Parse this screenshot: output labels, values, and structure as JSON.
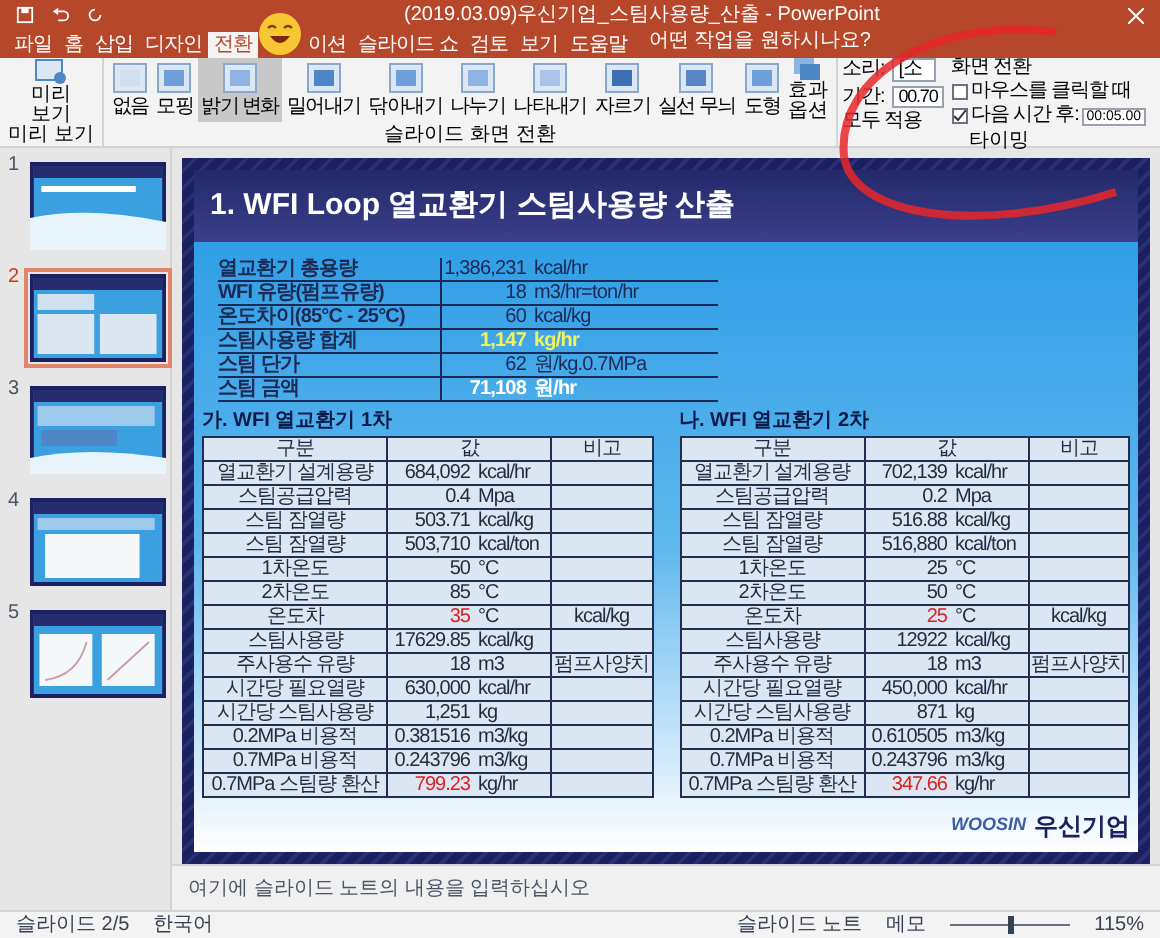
{
  "title_bar": {
    "title": "(2019.03.09)우신기업_스팀사용량_산출 - PowerPoint"
  },
  "menu_tabs": [
    {
      "label": "파일",
      "selected": false
    },
    {
      "label": "홈",
      "selected": false
    },
    {
      "label": "삽입",
      "selected": false
    },
    {
      "label": "디자인",
      "selected": false
    },
    {
      "label": "전환",
      "selected": true
    },
    {
      "label": "이션",
      "selected": false
    },
    {
      "label": "슬라이드 쇼",
      "selected": false
    },
    {
      "label": "검토",
      "selected": false
    },
    {
      "label": "보기",
      "selected": false
    },
    {
      "label": "도움말",
      "selected": false
    }
  ],
  "tell_me": "어떤 작업을 원하시나요?",
  "ribbon": {
    "preview": {
      "label": "미리 보기",
      "group": "미리 보기"
    },
    "transitions": [
      {
        "label": "없음",
        "selected": false
      },
      {
        "label": "모핑",
        "selected": false
      },
      {
        "label": "밝기 변화",
        "selected": true
      },
      {
        "label": "밀어내기",
        "selected": false
      },
      {
        "label": "닦아내기",
        "selected": false
      },
      {
        "label": "나누기",
        "selected": false
      },
      {
        "label": "나타내기",
        "selected": false
      },
      {
        "label": "자르기",
        "selected": false
      },
      {
        "label": "실선 무늬",
        "selected": false
      },
      {
        "label": "도형",
        "selected": false
      }
    ],
    "effect_options": "효과 옵션",
    "transitions_group": "슬라이드 화면 전환",
    "timing": {
      "sound_label": "소리:",
      "sound_value": "[소",
      "duration_label": "기간:",
      "duration_value": "00.70",
      "apply_all": "모두 적용",
      "advance_title": "화면 전환",
      "on_click": {
        "label": "마우스를 클릭할 때",
        "checked": false
      },
      "after": {
        "label": "다음 시간 후:",
        "checked": true,
        "value": "00:05.00"
      },
      "group": "타이밍"
    }
  },
  "thumbnails": [
    {
      "number": "1",
      "kind": "title",
      "selected": false
    },
    {
      "number": "2",
      "kind": "tables",
      "selected": true
    },
    {
      "number": "3",
      "kind": "text",
      "selected": false
    },
    {
      "number": "4",
      "kind": "list",
      "selected": false
    },
    {
      "number": "5",
      "kind": "charts",
      "selected": false
    }
  ],
  "slide": {
    "title": "1. WFI Loop 열교환기 스팀사용량 산출",
    "summary": [
      {
        "label": "열교환기 총용량",
        "value": "1,386,231",
        "unit": "kcal/hr",
        "kind": "normal"
      },
      {
        "label": "WFI 유량(펌프유량)",
        "value": "18",
        "unit": "m3/hr=ton/hr",
        "kind": "normal"
      },
      {
        "label": "온도차이(85°C - 25°C)",
        "value": "60",
        "unit": "kcal/kg",
        "kind": "normal"
      },
      {
        "label": "스팀사용량 합계",
        "value": "1,147",
        "unit": "kg/hr",
        "kind": "highlight"
      },
      {
        "label": "스팀 단가",
        "value": "62",
        "unit": "원/kg.0.7MPa",
        "kind": "normal"
      },
      {
        "label": "스팀 금액",
        "value": "71,108",
        "unit": "원/hr",
        "kind": "total"
      }
    ],
    "tables": [
      {
        "title": "가. WFI 열교환기 1차",
        "columns": [
          "구분",
          "값",
          "비고"
        ],
        "rows": [
          {
            "name": "열교환기 설계용량",
            "value": "684,092",
            "unit": "kcal/hr",
            "note": "",
            "alert": false
          },
          {
            "name": "스팀공급압력",
            "value": "0.4",
            "unit": "Mpa",
            "note": "",
            "alert": false
          },
          {
            "name": "스팀 잠열량",
            "value": "503.71",
            "unit": "kcal/kg",
            "note": "",
            "alert": false
          },
          {
            "name": "스팀 잠열량",
            "value": "503,710",
            "unit": "kcal/ton",
            "note": "",
            "alert": false
          },
          {
            "name": "1차온도",
            "value": "50",
            "unit": "°C",
            "note": "",
            "alert": false
          },
          {
            "name": "2차온도",
            "value": "85",
            "unit": "°C",
            "note": "",
            "alert": false
          },
          {
            "name": "온도차",
            "value": "35",
            "unit": "°C",
            "note": "kcal/kg",
            "alert": true
          },
          {
            "name": "스팀사용량",
            "value": "17629.85",
            "unit": "kcal/kg",
            "note": "",
            "alert": false
          },
          {
            "name": "주사용수 유량",
            "value": "18",
            "unit": "m3",
            "note": "펌프사양치",
            "alert": false
          },
          {
            "name": "시간당 필요열량",
            "value": "630,000",
            "unit": "kcal/hr",
            "note": "",
            "alert": false
          },
          {
            "name": "시간당 스팀사용량",
            "value": "1,251",
            "unit": "kg",
            "note": "",
            "alert": false
          },
          {
            "name": "0.2MPa 비용적",
            "value": "0.381516",
            "unit": "m3/kg",
            "note": "",
            "alert": false
          },
          {
            "name": "0.7MPa 비용적",
            "value": "0.243796",
            "unit": "m3/kg",
            "note": "",
            "alert": false
          },
          {
            "name": "0.7MPa 스팀량 환산",
            "value": "799.23",
            "unit": "kg/hr",
            "note": "",
            "alert": true
          }
        ]
      },
      {
        "title": "나. WFI 열교환기 2차",
        "columns": [
          "구분",
          "값",
          "비고"
        ],
        "rows": [
          {
            "name": "열교환기 설계용량",
            "value": "702,139",
            "unit": "kcal/hr",
            "note": "",
            "alert": false
          },
          {
            "name": "스팀공급압력",
            "value": "0.2",
            "unit": "Mpa",
            "note": "",
            "alert": false
          },
          {
            "name": "스팀 잠열량",
            "value": "516.88",
            "unit": "kcal/kg",
            "note": "",
            "alert": false
          },
          {
            "name": "스팀 잠열량",
            "value": "516,880",
            "unit": "kcal/ton",
            "note": "",
            "alert": false
          },
          {
            "name": "1차온도",
            "value": "25",
            "unit": "°C",
            "note": "",
            "alert": false
          },
          {
            "name": "2차온도",
            "value": "50",
            "unit": "°C",
            "note": "",
            "alert": false
          },
          {
            "name": "온도차",
            "value": "25",
            "unit": "°C",
            "note": "kcal/kg",
            "alert": true
          },
          {
            "name": "스팀사용량",
            "value": "12922",
            "unit": "kcal/kg",
            "note": "",
            "alert": false
          },
          {
            "name": "주사용수 유량",
            "value": "18",
            "unit": "m3",
            "note": "펌프사양치",
            "alert": false
          },
          {
            "name": "시간당 필요열량",
            "value": "450,000",
            "unit": "kcal/hr",
            "note": "",
            "alert": false
          },
          {
            "name": "시간당 스팀사용량",
            "value": "871",
            "unit": "kg",
            "note": "",
            "alert": false
          },
          {
            "name": "0.2MPa 비용적",
            "value": "0.610505",
            "unit": "m3/kg",
            "note": "",
            "alert": false
          },
          {
            "name": "0.7MPa 비용적",
            "value": "0.243796",
            "unit": "m3/kg",
            "note": "",
            "alert": false
          },
          {
            "name": "0.7MPa 스팀량 환산",
            "value": "347.66",
            "unit": "kg/hr",
            "note": "",
            "alert": true
          }
        ]
      }
    ],
    "logo": {
      "latin": "WOOSIN",
      "korean": "우신기업"
    }
  },
  "notes_placeholder": "여기에 슬라이드 노트의 내용을 입력하십시오",
  "status_bar": {
    "slide": "슬라이드 2/5",
    "language": "한국어",
    "notes": "슬라이드 노트",
    "comments": "메모",
    "zoom": "115%",
    "zoom_slider": {
      "level": 0.5
    }
  }
}
